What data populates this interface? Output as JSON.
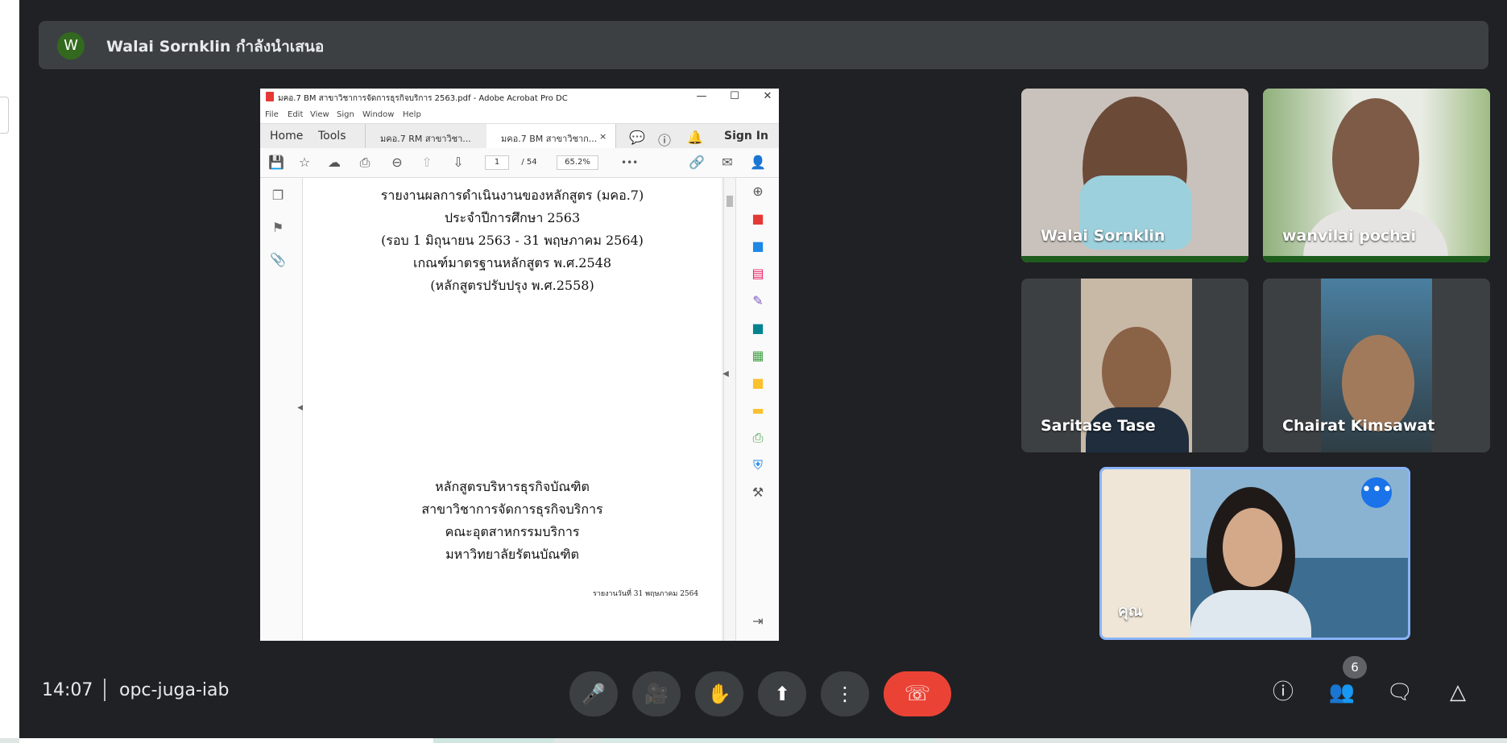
{
  "presenter_banner": {
    "avatar_letter": "W",
    "text": "Walai Sornklin กำลังนำเสนอ"
  },
  "shared_screen": {
    "window_title": "มคอ.7 BM สาขาวิชาการจัดการธุรกิจบริการ 2563.pdf - Adobe Acrobat Pro DC",
    "window_controls": [
      "—",
      "☐",
      "✕"
    ],
    "menu": [
      "File",
      "Edit",
      "View",
      "Sign",
      "Window",
      "Help"
    ],
    "home": "Home",
    "tools": "Tools",
    "doc_tabs": [
      "มคอ.7 RM สาขาวิชา...",
      "มคอ.7 BM สาขาวิชาก..."
    ],
    "tab_close": "×",
    "sign_in": "Sign In",
    "page_current": "1",
    "page_total": "/ 54",
    "zoom": "65.2%",
    "more": "•••",
    "doc_lines_top": [
      "รายงานผลการดำเนินงานของหลักสูตร (มคอ.7)",
      "ประจำปีการศึกษา 2563",
      "(รอบ 1 มิถุนายน 2563 - 31 พฤษภาคม 2564)",
      "เกณฑ์มาตรฐานหลักสูตร พ.ศ.2548",
      "(หลักสูตรปรับปรุง พ.ศ.2558)"
    ],
    "doc_lines_bottom": [
      "หลักสูตรบริหารธุรกิจบัณฑิต",
      "สาขาวิชาการจัดการธุรกิจบริการ",
      "คณะอุตสาหกรรมบริการ",
      "มหาวิทยาลัยรัตนบัณฑิต"
    ],
    "report_date": "รายงานวันที่ 31 พฤษภาคม 2564"
  },
  "participants": [
    {
      "name": "Walai Sornklin"
    },
    {
      "name": "wanvilai pochai"
    },
    {
      "name": "Saritase Tase"
    },
    {
      "name": "Chairat Kimsawat"
    },
    {
      "name": "คุณ"
    }
  ],
  "self_more": "•••",
  "bottom_bar": {
    "time": "14:07",
    "meeting_code": "opc-juga-iab",
    "participant_count": "6"
  },
  "colors": {
    "background": "#202124",
    "end_call": "#ea4335",
    "self_border": "#8ab4f8",
    "accent": "#1a73e8"
  }
}
